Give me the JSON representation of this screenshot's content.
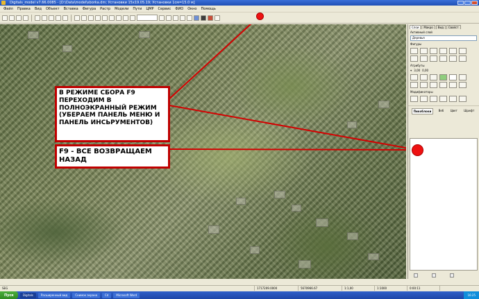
{
  "window": {
    "title": "Digitals_model v7.66.0085 - [D:\\Data\\model\\sborka.dm; Установки 15х19.05.19; Установки 1см=15.0 м]"
  },
  "menu": {
    "items": [
      "Файл",
      "Правка",
      "Вид",
      "Объект",
      "Вставка",
      "Фигура",
      "Растр",
      "Модели",
      "Пути",
      "ЦМР",
      "Сервис",
      "ФИО",
      "Окно",
      "Помощь"
    ]
  },
  "callouts": {
    "fullscreen": "В РЕЖИМЕ СБОРА F9 ПЕРЕХОДИМ В ПОЛНОЭКРАННЫЙ РЕЖИМ (УБЕРАЕМ ПАНЕЛЬ МЕНЮ И ПАНЕЛЬ ИНСЬРУМЕНТОВ)",
    "restore": "F9 - ВСЕ ВОЗВРАЩАЕМ НАЗАД"
  },
  "panel": {
    "tabs": [
      "Слои",
      "Макро",
      "Вид",
      "Свойст"
    ],
    "active_layer_label": "Активный слой",
    "layer_select": "Деревья",
    "shapes_label": "Фигуры",
    "attr_label": "Атрибуты",
    "coord_a": "3,00",
    "coord_b": "0,00",
    "modifiers_label": "Модификаторы",
    "bottom_tabs": [
      "Пикоблоки",
      "Веб",
      "Цвет",
      "Шрифт"
    ]
  },
  "status": {
    "mode": "SEG",
    "coord_x": "1717209.0000",
    "coord_y": "5670966.67",
    "zoom": "1:1,00",
    "scale": "1:1000",
    "extra": "0:00:11"
  },
  "taskbar": {
    "start": "Пуск",
    "tasks": [
      "Digitals",
      "Расширенный вид",
      "Снимок экрана",
      "Cd",
      "Microsoft Word"
    ],
    "clock": "16:25"
  },
  "colors": {
    "callout_border": "#c00000",
    "arrow": "#d40000",
    "dot": "#ee1111"
  }
}
